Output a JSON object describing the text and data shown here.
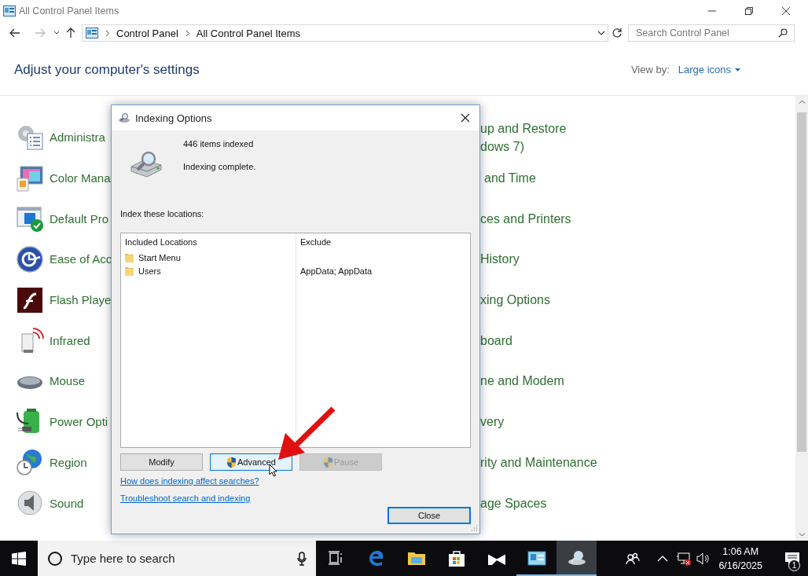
{
  "window": {
    "title": "All Control Panel Items"
  },
  "address": {
    "path": [
      "Control Panel",
      "All Control Panel Items"
    ],
    "search_placeholder": "Search Control Panel"
  },
  "header": {
    "title": "Adjust your computer's settings",
    "view_by_label": "View by:",
    "view_by_value": "Large icons"
  },
  "items_left": [
    {
      "label": "Administra"
    },
    {
      "label": "Color Mana"
    },
    {
      "label": "Default Pro"
    },
    {
      "label": "Ease of Acc"
    },
    {
      "label": "Flash Playe"
    },
    {
      "label": "Infrared"
    },
    {
      "label": "Mouse"
    },
    {
      "label": "Power Opti"
    },
    {
      "label": "Region"
    },
    {
      "label": "Sound"
    }
  ],
  "items_right": [
    {
      "lines": [
        "up and Restore",
        "dows 7)"
      ]
    },
    {
      "lines": [
        "and Time"
      ]
    },
    {
      "lines": [
        "ces and Printers"
      ]
    },
    {
      "lines": [
        "History"
      ]
    },
    {
      "lines": [
        "xing Options"
      ]
    },
    {
      "lines": [
        "board"
      ]
    },
    {
      "lines": [
        "ne and Modem"
      ]
    },
    {
      "lines": [
        "very"
      ]
    },
    {
      "lines": [
        "rity and Maintenance"
      ]
    },
    {
      "lines": [
        "age Spaces"
      ]
    }
  ],
  "dialog": {
    "title": "Indexing Options",
    "count": "446 items indexed",
    "status": "Indexing complete.",
    "locations_label": "Index these locations:",
    "columns": [
      "Included Locations",
      "Exclude"
    ],
    "rows": [
      {
        "location": "Start Menu"
      },
      {
        "location": "Users",
        "exclude": "AppData; AppData"
      }
    ],
    "buttons": [
      {
        "label": "Modify",
        "shield": false,
        "hovered": false,
        "disabled": false
      },
      {
        "label": "Advanced",
        "shield": true,
        "hovered": true,
        "disabled": false
      },
      {
        "label": "Pause",
        "shield": true,
        "hovered": false,
        "disabled": true
      }
    ],
    "links": [
      "How does indexing affect searches?",
      "Troubleshoot search and indexing"
    ],
    "close_button": {
      "label": "Close",
      "default": true
    }
  },
  "taskbar": {
    "search_placeholder": "Type here to search",
    "apps": [
      {
        "kind": "task-view",
        "running": false,
        "selected": false
      },
      {
        "kind": "browser",
        "running": false,
        "selected": false
      },
      {
        "kind": "files",
        "running": false,
        "selected": false
      },
      {
        "kind": "store",
        "running": false,
        "selected": false
      },
      {
        "kind": "mail",
        "running": false,
        "selected": false
      },
      {
        "kind": "control-panel",
        "running": true,
        "selected": false
      },
      {
        "kind": "indexing",
        "running": true,
        "selected": true
      }
    ],
    "time": "1:06 AM",
    "date": "6/16/2025",
    "notification_count": "1"
  }
}
